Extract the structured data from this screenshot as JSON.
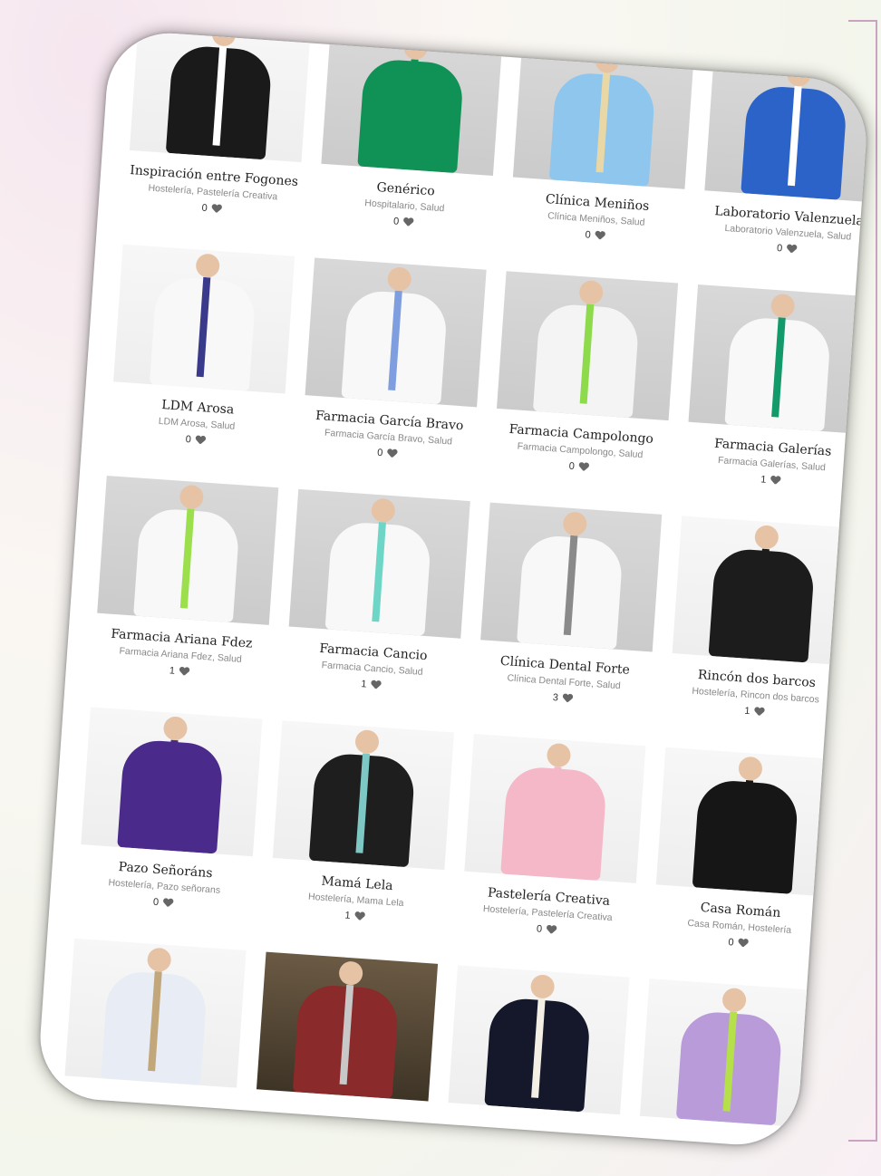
{
  "items": [
    {
      "title": "Inspiración entre Fogones",
      "categories": "Hostelería, Pastelería Creativa",
      "likes": "0",
      "garment": "#1a1a1a",
      "accent": "#ffffff",
      "bg": "light"
    },
    {
      "title": "Genérico",
      "categories": "Hospitalario, Salud",
      "likes": "0",
      "garment": "#109155",
      "accent": "#109155",
      "bg": "grey"
    },
    {
      "title": "Clínica Meniños",
      "categories": "Clínica Meniños, Salud",
      "likes": "0",
      "garment": "#8fc6ee",
      "accent": "#e9d8a6",
      "bg": "grey"
    },
    {
      "title": "Laboratorio Valenzuela",
      "categories": "Laboratorio Valenzuela, Salud",
      "likes": "0",
      "garment": "#2c63c8",
      "accent": "#ffffff",
      "bg": "grey"
    },
    {
      "title": "LDM Arosa",
      "categories": "LDM Arosa, Salud",
      "likes": "0",
      "garment": "#f8f8f8",
      "accent": "#3a3a8c",
      "bg": "light"
    },
    {
      "title": "Farmacia García Bravo",
      "categories": "Farmacia García Bravo, Salud",
      "likes": "0",
      "garment": "#f8f8f8",
      "accent": "#7f9ee0",
      "bg": "grey"
    },
    {
      "title": "Farmacia Campolongo",
      "categories": "Farmacia Campolongo, Salud",
      "likes": "0",
      "garment": "#f4f4f4",
      "accent": "#8ddb4a",
      "bg": "grey"
    },
    {
      "title": "Farmacia Galerías",
      "categories": "Farmacia Galerías, Salud",
      "likes": "1",
      "garment": "#f8f8f8",
      "accent": "#129a6a",
      "bg": "grey"
    },
    {
      "title": "Farmacia Ariana Fdez",
      "categories": "Farmacia Ariana Fdez, Salud",
      "likes": "1",
      "garment": "#f8f8f8",
      "accent": "#9be04c",
      "bg": "grey"
    },
    {
      "title": "Farmacia Cancio",
      "categories": "Farmacia Cancio, Salud",
      "likes": "1",
      "garment": "#f8f8f8",
      "accent": "#6ed6c6",
      "bg": "grey"
    },
    {
      "title": "Clínica Dental Forte",
      "categories": "Clínica Dental Forte, Salud",
      "likes": "3",
      "garment": "#f8f8f8",
      "accent": "#8a8a8a",
      "bg": "grey"
    },
    {
      "title": "Rincón dos barcos",
      "categories": "Hostelería, Rincon dos barcos",
      "likes": "1",
      "garment": "#1c1c1c",
      "accent": "#1c1c1c",
      "bg": "light"
    },
    {
      "title": "Pazo Señoráns",
      "categories": "Hostelería, Pazo señorans",
      "likes": "0",
      "garment": "#4a2a8a",
      "accent": "#4a2a8a",
      "bg": "light"
    },
    {
      "title": "Mamá Lela",
      "categories": "Hostelería, Mama Lela",
      "likes": "1",
      "garment": "#1e1e1e",
      "accent": "#7dc7c4",
      "bg": "light"
    },
    {
      "title": "Pastelería Creativa",
      "categories": "Hostelería, Pastelería Creativa",
      "likes": "0",
      "garment": "#f5b8c8",
      "accent": "#f5b8c8",
      "bg": "light"
    },
    {
      "title": "Casa Román",
      "categories": "Casa Román, Hostelería",
      "likes": "0",
      "garment": "#161616",
      "accent": "#161616",
      "bg": "light"
    },
    {
      "title": "",
      "categories": "",
      "likes": "",
      "garment": "#e8ecf5",
      "accent": "#c2a77a",
      "bg": "light"
    },
    {
      "title": "",
      "categories": "",
      "likes": "",
      "garment": "#8a2a2a",
      "accent": "#c8c8c8",
      "bg": "photo"
    },
    {
      "title": "",
      "categories": "",
      "likes": "",
      "garment": "#15182a",
      "accent": "#f4efe4",
      "bg": "light"
    },
    {
      "title": "",
      "categories": "",
      "likes": "",
      "garment": "#b89bd8",
      "accent": "#b6e04a",
      "bg": "light"
    }
  ]
}
